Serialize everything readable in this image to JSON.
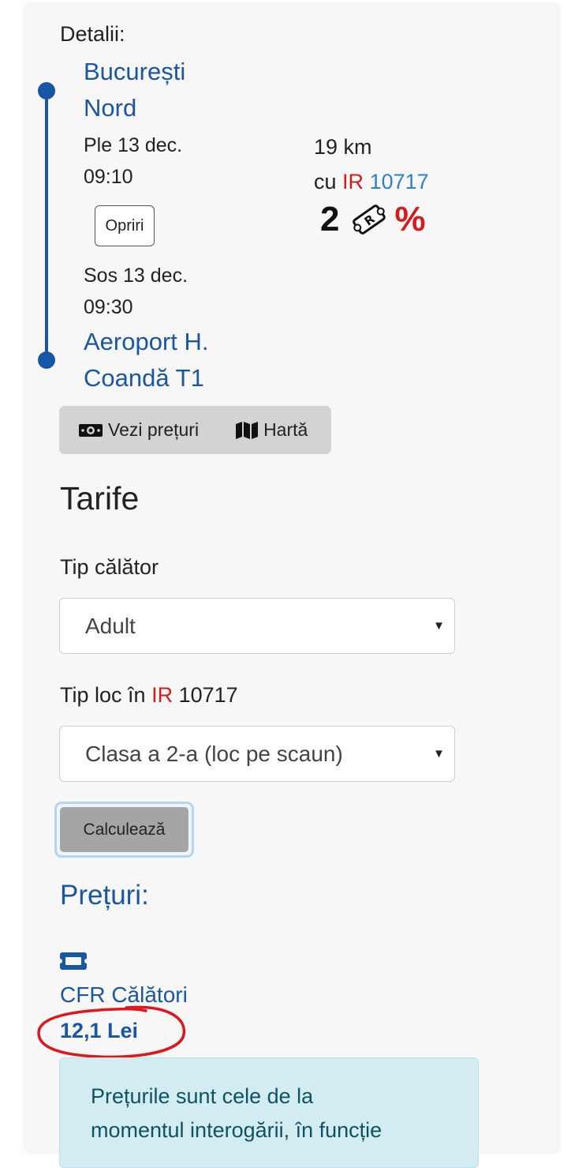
{
  "details": {
    "label": "Detalii:",
    "departure": {
      "station_line1": "București",
      "station_line2": "Nord",
      "date": "Ple 13 dec.",
      "time": "09:10"
    },
    "stops_button": "Opriri",
    "arrival": {
      "date": "Sos 13 dec.",
      "time": "09:30",
      "station_line1": "Aeroport H.",
      "station_line2": "Coandă T1"
    },
    "train": {
      "distance": "19 km",
      "prefix": "cu",
      "category": "IR",
      "number": "10717",
      "class_digit": "2",
      "percent": "%"
    }
  },
  "actions": {
    "prices": "Vezi prețuri",
    "map": "Hartă"
  },
  "tarife": {
    "title": "Tarife",
    "traveler_label": "Tip călător",
    "traveler_value": "Adult",
    "seat_label_prefix": "Tip loc în",
    "seat_label_category": "IR",
    "seat_label_number": "10717",
    "seat_value": "Clasa a 2-a (loc pe scaun)",
    "calculate": "Calculează"
  },
  "prices": {
    "title": "Prețuri:",
    "operator": "CFR Călători",
    "amount": "12,1 Lei",
    "notice_line1": "Prețurile sunt cele de la",
    "notice_line2": "momentul interogării, în funcție"
  },
  "colors": {
    "link_blue": "#1a56a2",
    "train_red": "#d51c1c",
    "train_number_blue": "#2b7fd4",
    "annotation_red": "#e0161c"
  }
}
